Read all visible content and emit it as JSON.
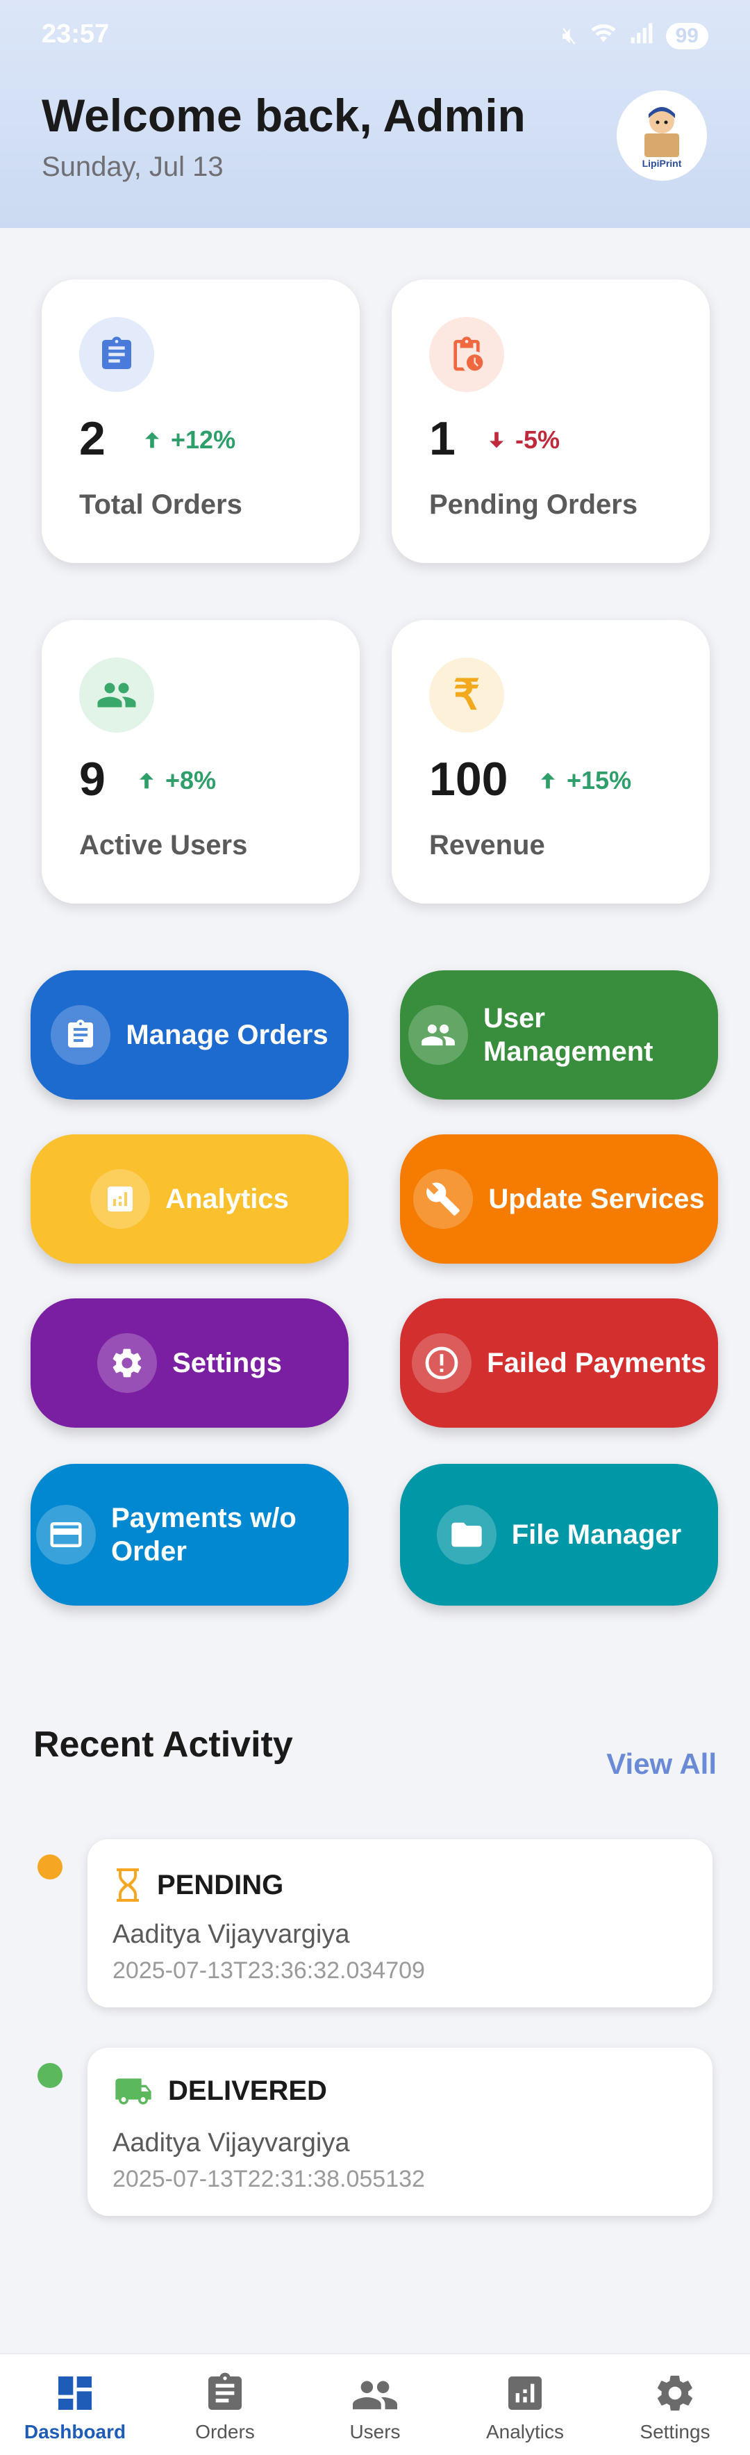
{
  "status_bar": {
    "time": "23:57",
    "battery": "99"
  },
  "header": {
    "title": "Welcome back, Admin",
    "date": "Sunday, Jul 13",
    "avatar_text": "LipiPrint"
  },
  "stats": [
    {
      "value": "2",
      "trend": "+12%",
      "direction": "up",
      "label": "Total Orders",
      "icon": "clipboard-icon",
      "icon_color": "#4A7BDA",
      "icon_bg": "#E3EBFA",
      "trend_color": "#2E9E6A"
    },
    {
      "value": "1",
      "trend": "-5%",
      "direction": "down",
      "label": "Pending Orders",
      "icon": "pending-clipboard-icon",
      "icon_color": "#F0683F",
      "icon_bg": "#FDE7E1",
      "trend_color": "#C0283C"
    },
    {
      "value": "9",
      "trend": "+8%",
      "direction": "up",
      "label": "Active Users",
      "icon": "group-icon",
      "icon_color": "#3AA86A",
      "icon_bg": "#E2F3E8",
      "trend_color": "#2E9E6A"
    },
    {
      "value": "100",
      "trend": "+15%",
      "direction": "up",
      "label": "Revenue",
      "icon": "rupee-icon",
      "icon_color": "#F2A91E",
      "icon_bg": "#FDF2D9",
      "trend_color": "#2E9E6A"
    }
  ],
  "actions": [
    {
      "label": "Manage Orders",
      "icon": "clipboard-icon",
      "color": "#1E6BD0"
    },
    {
      "label": "User Management",
      "icon": "group-icon",
      "color": "#388E3C"
    },
    {
      "label": "Analytics",
      "icon": "analytics-icon",
      "color": "#FBC02D"
    },
    {
      "label": "Update Services",
      "icon": "wrench-icon",
      "color": "#F57C00"
    },
    {
      "label": "Settings",
      "icon": "gear-icon",
      "color": "#7B1FA2"
    },
    {
      "label": "Failed Payments",
      "icon": "alert-icon",
      "color": "#D32F2F"
    },
    {
      "label": "Payments w/o Order",
      "icon": "credit-card-icon",
      "color": "#0288D1"
    },
    {
      "label": "File Manager",
      "icon": "folder-icon",
      "color": "#0097A7"
    }
  ],
  "recent_activity": {
    "title": "Recent Activity",
    "view_all": "View All",
    "items": [
      {
        "status": "PENDING",
        "name": "Aaditya Vijayvargiya",
        "timestamp": "2025-07-13T23:36:32.034709",
        "dot_color": "#F5A623",
        "icon": "hourglass-icon",
        "icon_color": "#F5A623"
      },
      {
        "status": "DELIVERED",
        "name": "Aaditya Vijayvargiya",
        "timestamp": "2025-07-13T22:31:38.055132",
        "dot_color": "#5CB85C",
        "icon": "truck-icon",
        "icon_color": "#5CB85C"
      }
    ]
  },
  "bottom_nav": [
    {
      "label": "Dashboard",
      "icon": "dashboard-icon",
      "active": true
    },
    {
      "label": "Orders",
      "icon": "clipboard-icon",
      "active": false
    },
    {
      "label": "Users",
      "icon": "group-icon",
      "active": false
    },
    {
      "label": "Analytics",
      "icon": "analytics-icon",
      "active": false
    },
    {
      "label": "Settings",
      "icon": "gear-icon",
      "active": false
    }
  ]
}
